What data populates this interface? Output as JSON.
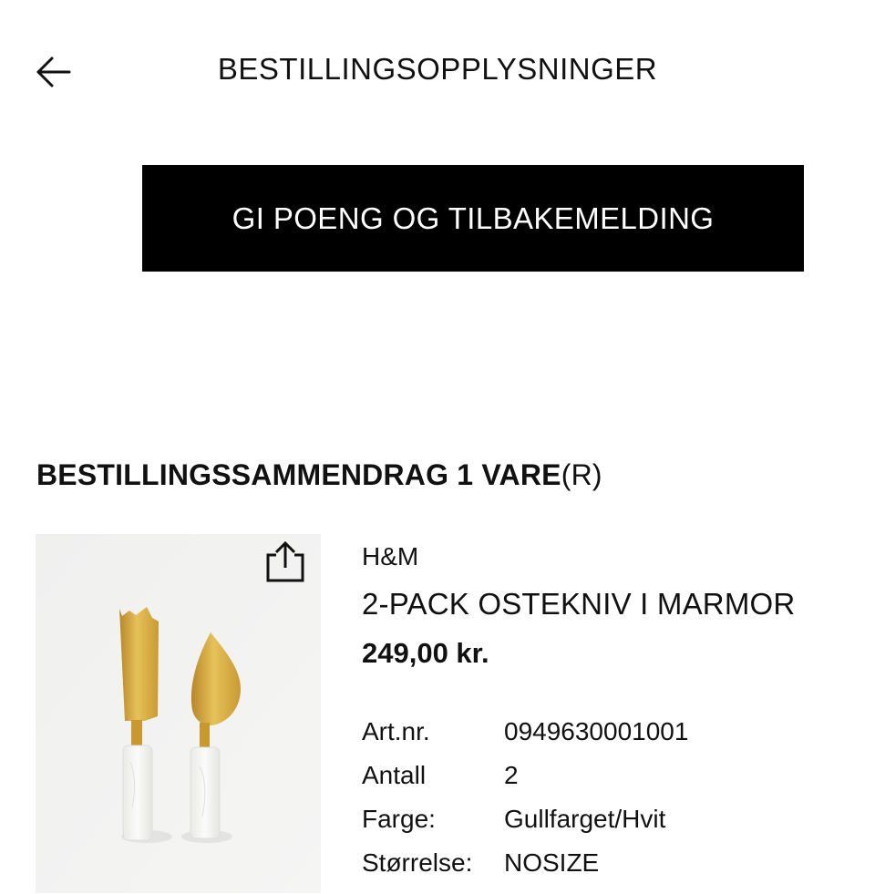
{
  "header": {
    "back_icon": "arrow-left-icon",
    "title": "BESTILLINGSOPPLYSNINGER"
  },
  "cta": {
    "label": "GI POENG OG TILBAKEMELDING"
  },
  "summary": {
    "heading": "BESTILLINGSSAMMENDRAG 1 VARE",
    "heading_suffix": "(R)"
  },
  "product": {
    "image_icon": "cheese-knives-image",
    "share_icon": "share-icon",
    "brand": "H&M",
    "name": "2-PACK OSTEKNIV I MARMOR",
    "price": "249,00 kr.",
    "details": [
      {
        "label": "Art.nr.",
        "value": "0949630001001"
      },
      {
        "label": "Antall",
        "value": "2"
      },
      {
        "label": "Farge:",
        "value": "Gullfarget/Hvit"
      },
      {
        "label": "Størrelse:",
        "value": "NOSIZE"
      }
    ]
  },
  "colors": {
    "button_bg": "#000000",
    "button_text": "#ffffff",
    "text": "#111111",
    "gold": "#d4a73a",
    "marble": "#f4f4f2"
  }
}
